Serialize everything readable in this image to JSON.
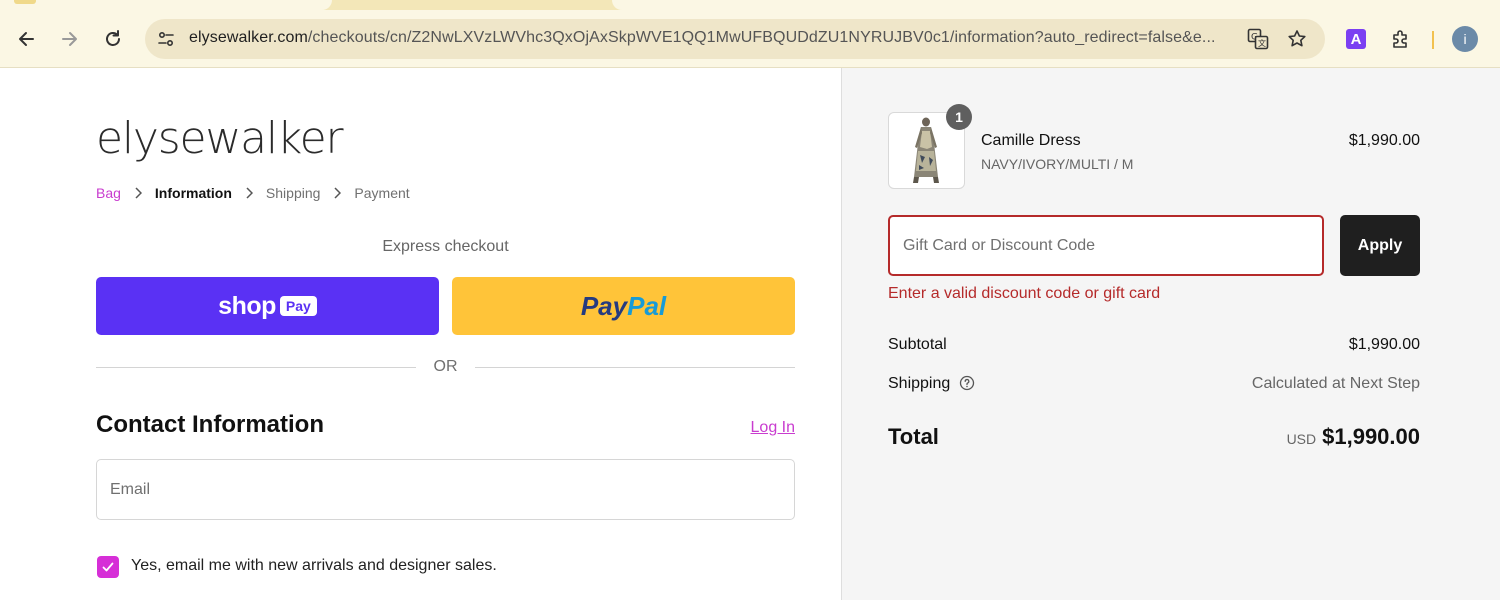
{
  "browser": {
    "url_host": "elysewalker.com",
    "url_path": "/checkouts/cn/Z2NwLXVzLWVhc3QxOjAxSkpWVE1QQ1MwUFBQUDdZU1NYRUJBV0c1/information?auto_redirect=false&e...",
    "profile_initial": "i",
    "extension_a_label": "A",
    "icons": [
      "back-icon",
      "forward-icon",
      "reload-icon",
      "site-info-icon",
      "translate-icon",
      "star-icon",
      "puzzle-icon"
    ]
  },
  "brand": {
    "logo_text": "elysewalker",
    "accent_color": "#c93ccf"
  },
  "breadcrumb": {
    "items": [
      {
        "label": "Bag",
        "state": "link"
      },
      {
        "label": "Information",
        "state": "current"
      },
      {
        "label": "Shipping",
        "state": "upcoming"
      },
      {
        "label": "Payment",
        "state": "upcoming"
      }
    ]
  },
  "express": {
    "label": "Express checkout",
    "shop_pay": {
      "word": "shop",
      "pill": "Pay",
      "color": "#5a31f4"
    },
    "paypal": {
      "part1": "Pay",
      "part2": "Pal",
      "color": "#ffc439"
    },
    "or_label": "OR"
  },
  "contact": {
    "title": "Contact Information",
    "login_label": "Log In",
    "email_placeholder": "Email",
    "email_value": "",
    "marketing_label": "Yes, email me with new arrivals and designer sales.",
    "marketing_checked": true
  },
  "order": {
    "item": {
      "quantity": "1",
      "name": "Camille Dress",
      "variant": "NAVY/IVORY/MULTI / M",
      "price": "$1,990.00"
    },
    "discount": {
      "placeholder": "Gift Card or Discount Code",
      "value": "",
      "apply_label": "Apply",
      "error": "Enter a valid discount code or gift card",
      "error_color": "#b52a2a"
    },
    "subtotal_label": "Subtotal",
    "subtotal_value": "$1,990.00",
    "shipping_label": "Shipping",
    "shipping_value": "Calculated at Next Step",
    "total_label": "Total",
    "total_currency": "USD",
    "total_value": "$1,990.00"
  }
}
